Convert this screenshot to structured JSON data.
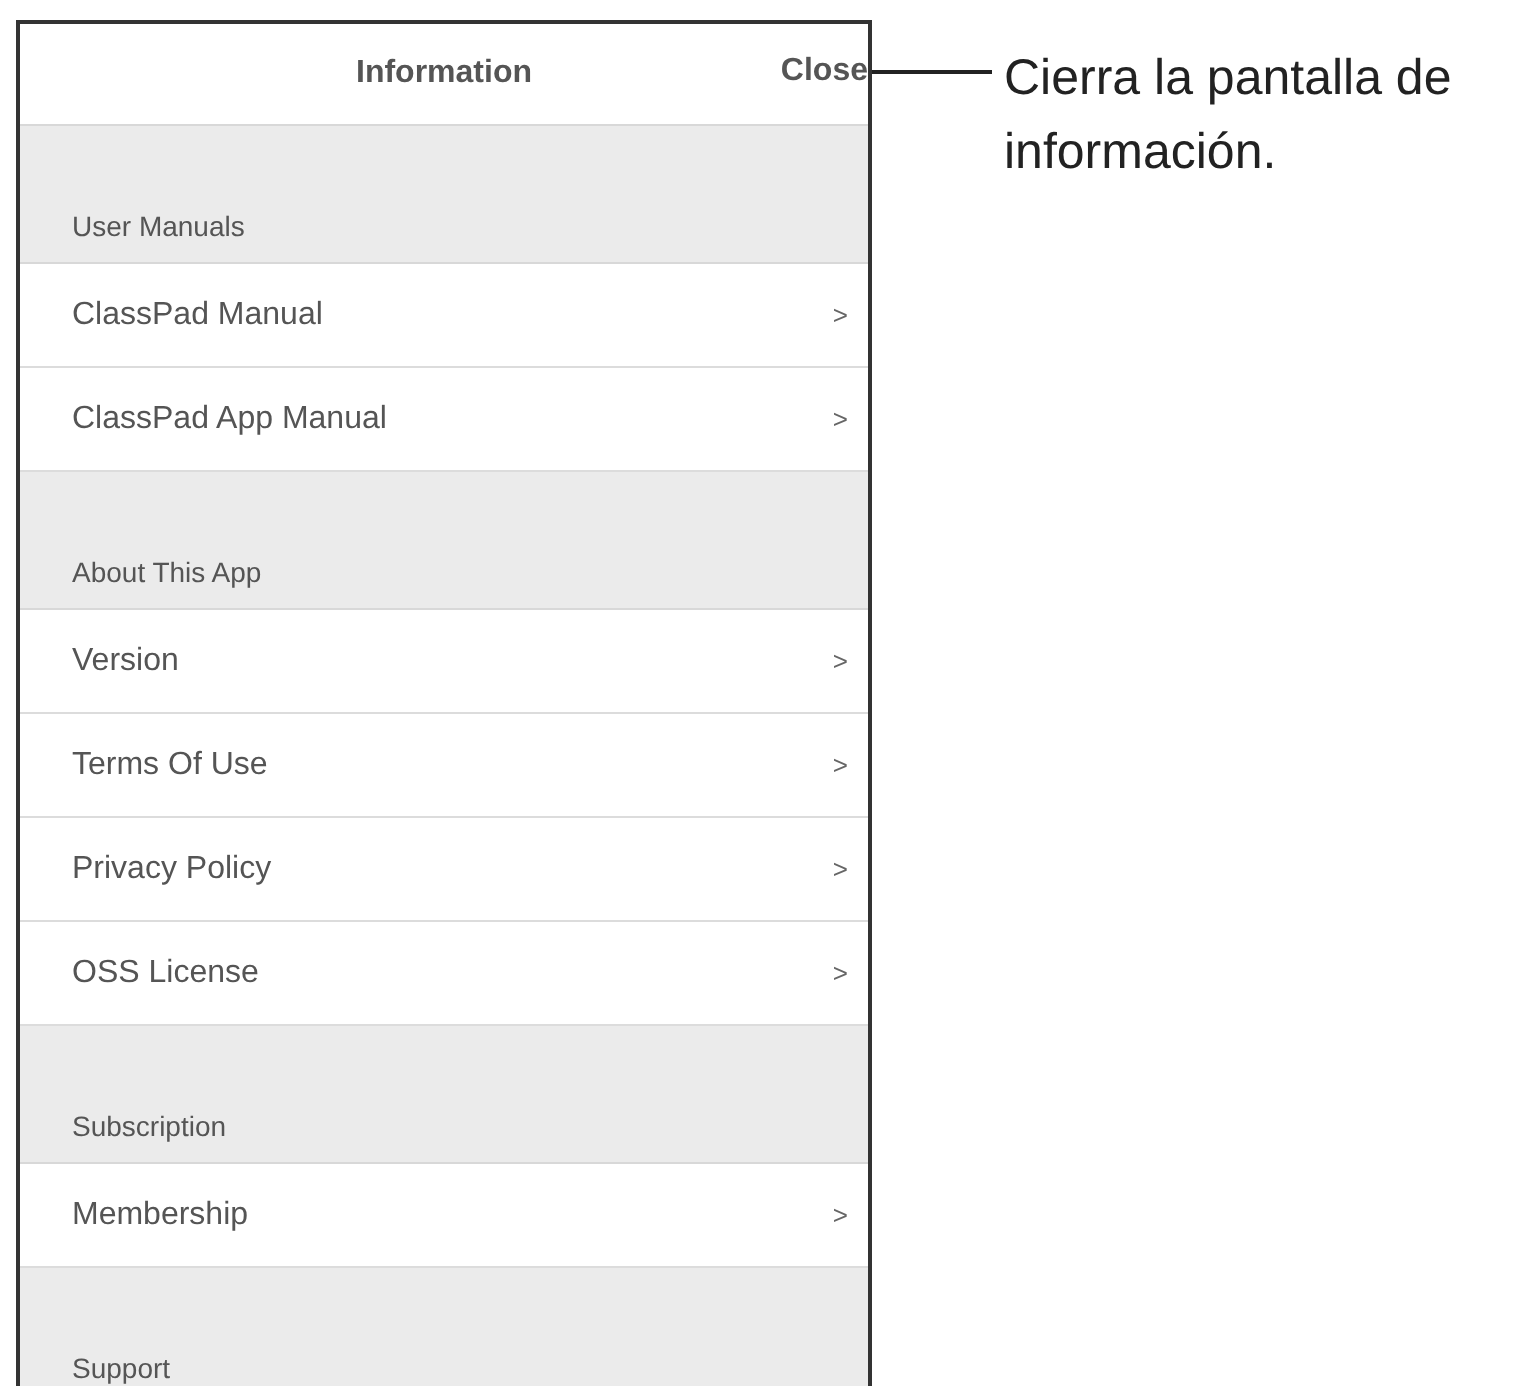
{
  "screen": {
    "title": "Information",
    "close": "Close"
  },
  "sections": [
    {
      "heading": "User Manuals",
      "items": [
        {
          "label": "ClassPad Manual",
          "chevron": ">"
        },
        {
          "label": "ClassPad App Manual",
          "chevron": ">"
        }
      ]
    },
    {
      "heading": "About This App",
      "items": [
        {
          "label": "Version",
          "chevron": ">"
        },
        {
          "label": "Terms Of Use",
          "chevron": ">"
        },
        {
          "label": "Privacy Policy",
          "chevron": ">"
        },
        {
          "label": "OSS License",
          "chevron": ">"
        }
      ]
    },
    {
      "heading": "Subscription",
      "items": [
        {
          "label": "Membership",
          "chevron": ">"
        }
      ]
    },
    {
      "heading": "Support"
    }
  ],
  "annotation": "Cierra la pantalla de información."
}
